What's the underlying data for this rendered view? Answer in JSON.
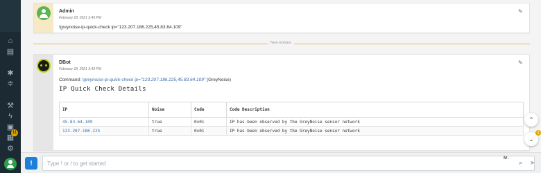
{
  "sidebar": {
    "icons": [
      "home-icon",
      "list-icon",
      "bug-icon",
      "sliders-icon",
      "wrench-icon",
      "bolt-icon",
      "briefcase-icon",
      "inbox-icon",
      "gear-icon"
    ],
    "inbox_badge": "11"
  },
  "messages": [
    {
      "author": "Admin",
      "timestamp": "February 18, 2021 3:49 PM",
      "text": "!greynoise-ip-quick-check ip=\"123.207.186.225,45.83.64.109\""
    },
    {
      "author": "DBot",
      "timestamp": "February 18, 2021 3:49 PM",
      "command_prefix": "Command:",
      "command": "!greynoise-ip-quick-check ip=\"123.207.186.225,45.83.64.109\"",
      "command_source": "(GreyNoise)",
      "report_title": "IP Quick Check Details"
    }
  ],
  "divider_label": "New Entries",
  "results_table": {
    "headers": [
      "IP",
      "Noise",
      "Code",
      "Code Description"
    ],
    "rows": [
      [
        "45.83.64.109",
        "true",
        "0x01",
        "IP has been observed by the GreyNoise sensor network"
      ],
      [
        "123.207.186.225",
        "true",
        "0x01",
        "IP has been observed by the GreyNoise sensor network"
      ]
    ]
  },
  "scroll_badge": "1",
  "input": {
    "placeholder": "Type ! or / to get started",
    "markdown_label": "M↓"
  },
  "colors": {
    "sidebar_bg": "#1c2b33",
    "accent_blue": "#1d7fd8",
    "divider_orange": "#f0b54b",
    "badge_yellow": "#e0a800",
    "link_blue": "#3a6fb0"
  }
}
